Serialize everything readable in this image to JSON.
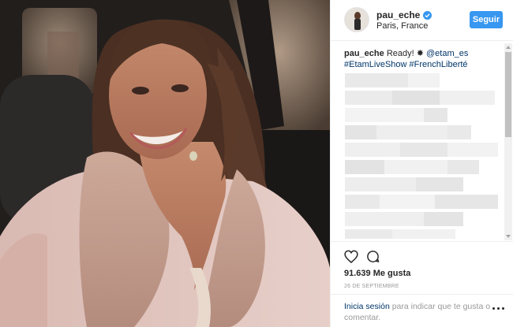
{
  "post": {
    "username": "pau_eche",
    "location": "Paris, France",
    "follow_label": "Seguir",
    "verified_icon": "verified-badge-icon"
  },
  "caption": {
    "username": "pau_eche",
    "text": "Ready!",
    "emoji": "✸",
    "mention": "@etam_es",
    "hashtags": "#EtamLiveShow #FrenchLiberté"
  },
  "actions": {
    "likes": "91.639 Me gusta",
    "date": "26 DE SEPTIEMBRE",
    "like_icon": "heart-icon",
    "comment_icon": "comment-icon"
  },
  "login": {
    "link": "Inicia sesión",
    "text": "para indicar que te gusta o comentar."
  },
  "colors": {
    "accent": "#3897f0",
    "link": "#003569",
    "muted": "#999999"
  }
}
